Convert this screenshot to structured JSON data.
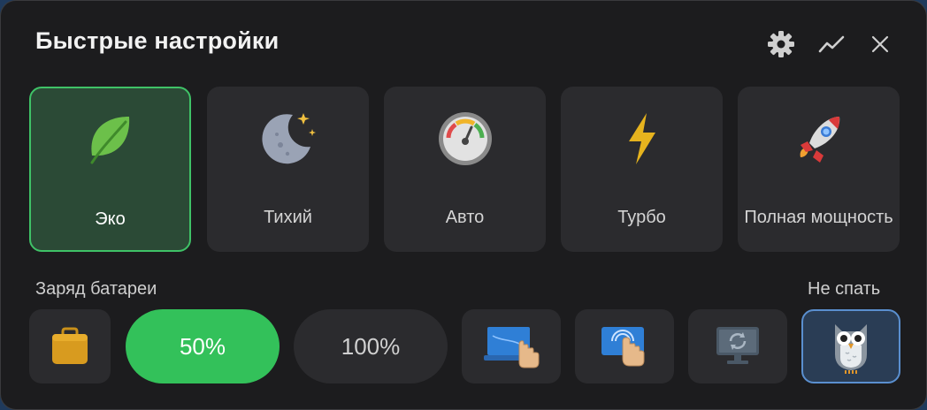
{
  "header": {
    "title": "Быстрые настройки",
    "icons": [
      "gear-icon",
      "chart-line-icon",
      "close-icon"
    ]
  },
  "modes": [
    {
      "label": "Эко",
      "icon": "leaf-icon",
      "active": true
    },
    {
      "label": "Тихий",
      "icon": "moon-icon",
      "active": false
    },
    {
      "label": "Авто",
      "icon": "gauge-icon",
      "active": false
    },
    {
      "label": "Турбо",
      "icon": "lightning-icon",
      "active": false
    },
    {
      "label": "Полная мощность",
      "icon": "rocket-icon",
      "active": false
    }
  ],
  "battery": {
    "label": "Заряд батареи",
    "icon": "battery-bag-icon",
    "option_50": "50%",
    "option_100": "100%",
    "selected": "50%"
  },
  "tools": [
    "laptop-touchpad-icon",
    "touch-screen-icon",
    "monitor-refresh-icon"
  ],
  "no_sleep": {
    "label": "Не спать",
    "icon": "owl-icon",
    "active": true
  },
  "colors": {
    "panel_bg": "#1c1c1e",
    "tile_bg": "#2b2b2e",
    "accent_green": "#33c15a",
    "active_tile_bg": "#2b4a36",
    "owl_border": "#5a8fcf"
  }
}
